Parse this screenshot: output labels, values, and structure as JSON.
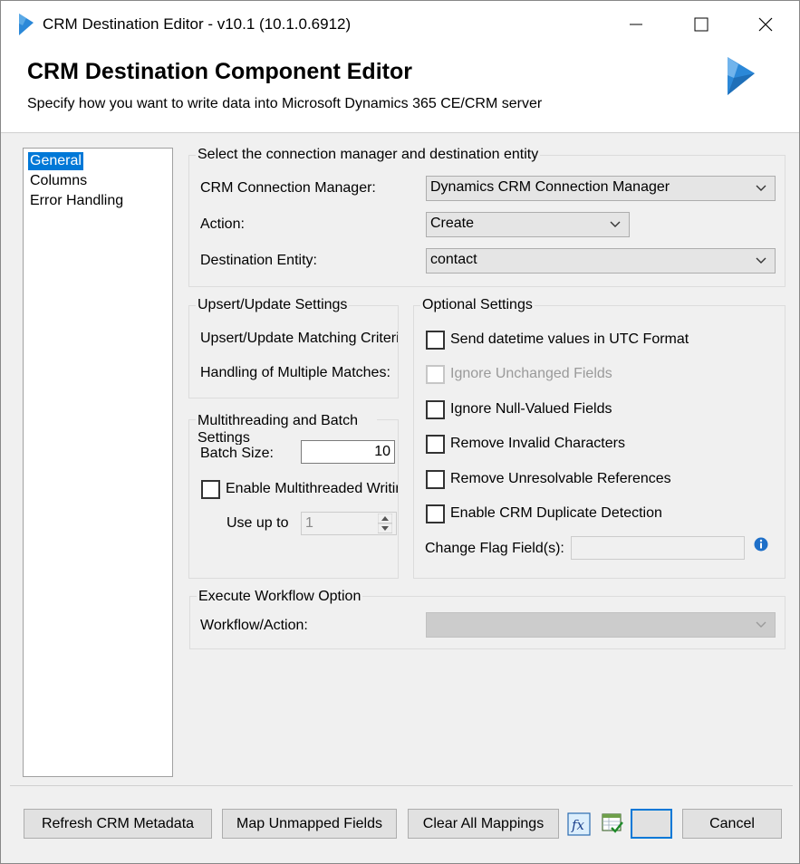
{
  "window": {
    "title": "CRM Destination Editor - v10.1 (10.1.0.6912)",
    "controls": [
      "minimize-icon",
      "maximize-icon",
      "close-icon"
    ]
  },
  "header": {
    "title": "CRM Destination Component Editor",
    "subtitle": "Specify how you want to write data into Microsoft Dynamics 365 CE/CRM server"
  },
  "nav": {
    "items": [
      {
        "label": "General",
        "selected": true
      },
      {
        "label": "Columns",
        "selected": false
      },
      {
        "label": "Error Handling",
        "selected": false
      }
    ]
  },
  "connection_group": {
    "title": "Select the connection manager and destination entity",
    "crm_connection_manager_label": "CRM Connection Manager:",
    "crm_connection_manager_value": "Dynamics CRM Connection Manager",
    "action_label": "Action:",
    "action_value": "Create",
    "destination_entity_label": "Destination Entity:",
    "destination_entity_value": "contact"
  },
  "upsert_group": {
    "title": "Upsert/Update Settings",
    "matching_criteria_label": "Upsert/Update Matching Criteri",
    "multiple_matches_label": "Handling of Multiple Matches:"
  },
  "multithreading_group": {
    "title": "Multithreading and Batch Settings",
    "batch_size_label": "Batch Size:",
    "batch_size_value": "10",
    "enable_multithreaded_label": "Enable Multithreaded Writin",
    "enable_multithreaded_checked": false,
    "use_up_to_label": "Use up to",
    "use_up_to_value": "1"
  },
  "optional_group": {
    "title": "Optional Settings",
    "options": [
      {
        "label": "Send datetime values in UTC Format",
        "checked": false,
        "enabled": true
      },
      {
        "label": "Ignore Unchanged Fields",
        "checked": false,
        "enabled": false
      },
      {
        "label": "Ignore Null-Valued Fields",
        "checked": false,
        "enabled": true
      },
      {
        "label": "Remove Invalid Characters",
        "checked": false,
        "enabled": true
      },
      {
        "label": "Remove Unresolvable References",
        "checked": false,
        "enabled": true
      },
      {
        "label": "Enable CRM Duplicate Detection",
        "checked": false,
        "enabled": true
      }
    ],
    "change_flag_label": "Change Flag Field(s):",
    "change_flag_value": "",
    "info_icon": "info-icon"
  },
  "workflow_group": {
    "title": "Execute Workflow Option",
    "workflow_action_label": "Workflow/Action:",
    "workflow_action_value": ""
  },
  "footer": {
    "refresh_label": "Refresh CRM Metadata",
    "map_unmapped_label": "Map Unmapped Fields",
    "clear_all_label": "Clear All Mappings",
    "fx_icon": "fx-icon",
    "grid_check_icon": "grid-check-icon",
    "ok_label": "",
    "cancel_label": "Cancel"
  },
  "colors": {
    "accent": "#0078d7",
    "dynamics_logo": "#2b88d8"
  }
}
